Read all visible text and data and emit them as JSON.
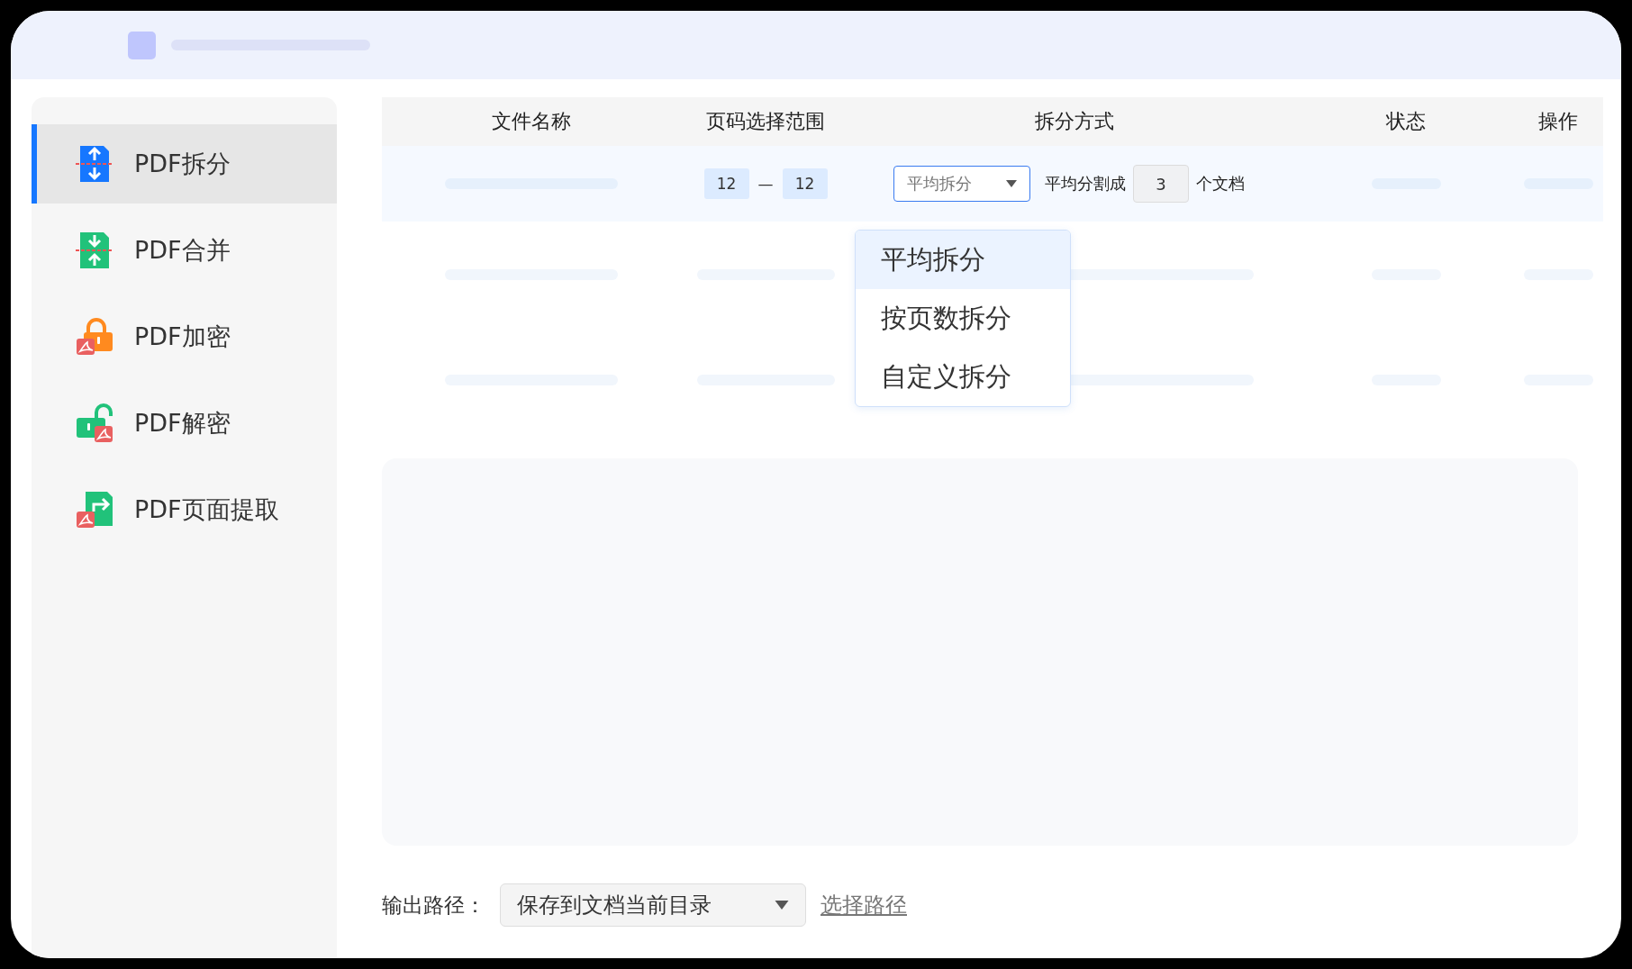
{
  "sidebar": {
    "items": [
      {
        "label": "PDF拆分",
        "kind": "split",
        "selected": true
      },
      {
        "label": "PDF合并",
        "kind": "merge",
        "selected": false
      },
      {
        "label": "PDF加密",
        "kind": "lock",
        "selected": false
      },
      {
        "label": "PDF解密",
        "kind": "unlock",
        "selected": false
      },
      {
        "label": "PDF页面提取",
        "kind": "extract",
        "selected": false
      }
    ]
  },
  "table": {
    "columns": [
      "文件名称",
      "页码选择范围",
      "拆分方式",
      "状态",
      "操作"
    ],
    "rows": [
      {
        "page_from": "12",
        "page_separator": "—",
        "page_to": "12",
        "split_mode": {
          "value": "平均拆分",
          "expanded": true,
          "options": [
            {
              "label": "平均拆分",
              "selected": true
            },
            {
              "label": "按页数拆分",
              "selected": false
            },
            {
              "label": "自定义拆分",
              "selected": false
            }
          ]
        },
        "split_label": "平均分割成",
        "split_count": "3",
        "split_suffix": "个文档"
      }
    ]
  },
  "output": {
    "label": "输出路径：",
    "path": "保存到文档当前目录",
    "link": "选择路径"
  }
}
